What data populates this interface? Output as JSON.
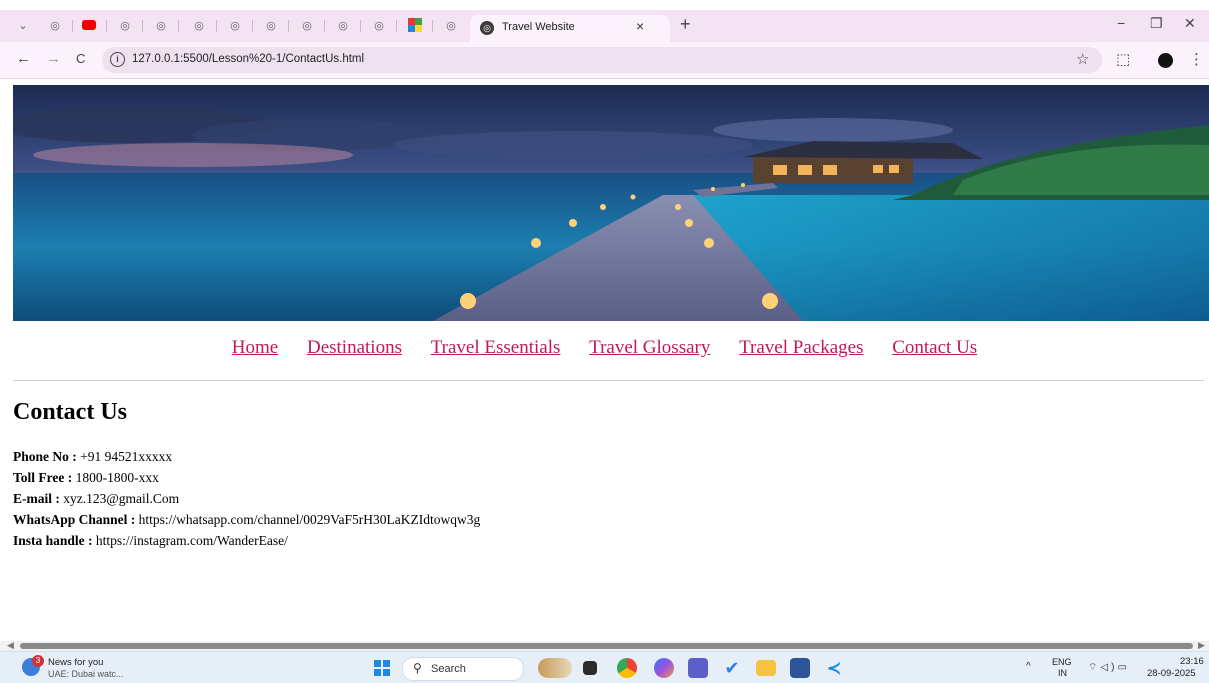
{
  "browser": {
    "active_tab_title": "Travel Website",
    "tab_close": "×",
    "new_tab": "+",
    "url": "127.0.0.1:5500/Lesson%20-1/ContactUs.html",
    "back": "←",
    "forward": "→",
    "reload": "C",
    "star": "☆",
    "extensions": "⬚",
    "menu": "⋮",
    "minimize": "−",
    "restore": "❐",
    "close": "✕",
    "tab_list": "⌄"
  },
  "nav": {
    "items": [
      {
        "label": "Home"
      },
      {
        "label": "Destinations"
      },
      {
        "label": "Travel Essentials"
      },
      {
        "label": "Travel Glossary"
      },
      {
        "label": "Travel Packages"
      },
      {
        "label": "Contact Us"
      }
    ]
  },
  "page": {
    "title": "Contact Us",
    "contacts": [
      {
        "label": "Phone No :",
        "value": " +91 94521xxxxx"
      },
      {
        "label": "Toll Free :",
        "value": " 1800-1800-xxx"
      },
      {
        "label": "E-mail :",
        "value": " xyz.123@gmail.Com"
      },
      {
        "label": "WhatsApp Channel :",
        "value": " https://whatsapp.com/channel/0029VaF5rH30LaKZIdtowqw3g"
      },
      {
        "label": "Insta handle :",
        "value": " https://instagram.com/WanderEase/"
      }
    ]
  },
  "taskbar": {
    "news_badge": "3",
    "news_title": "News for you",
    "news_sub": "UAE: Dubai watc...",
    "search_placeholder": "Search",
    "lang_top": "ENG",
    "lang_bottom": "IN",
    "time": "23:16",
    "date": "28-09-2025"
  },
  "colors": {
    "link": "#c2185b",
    "tab_strip": "#f3e3f3",
    "taskbar": "#e6eef7"
  }
}
